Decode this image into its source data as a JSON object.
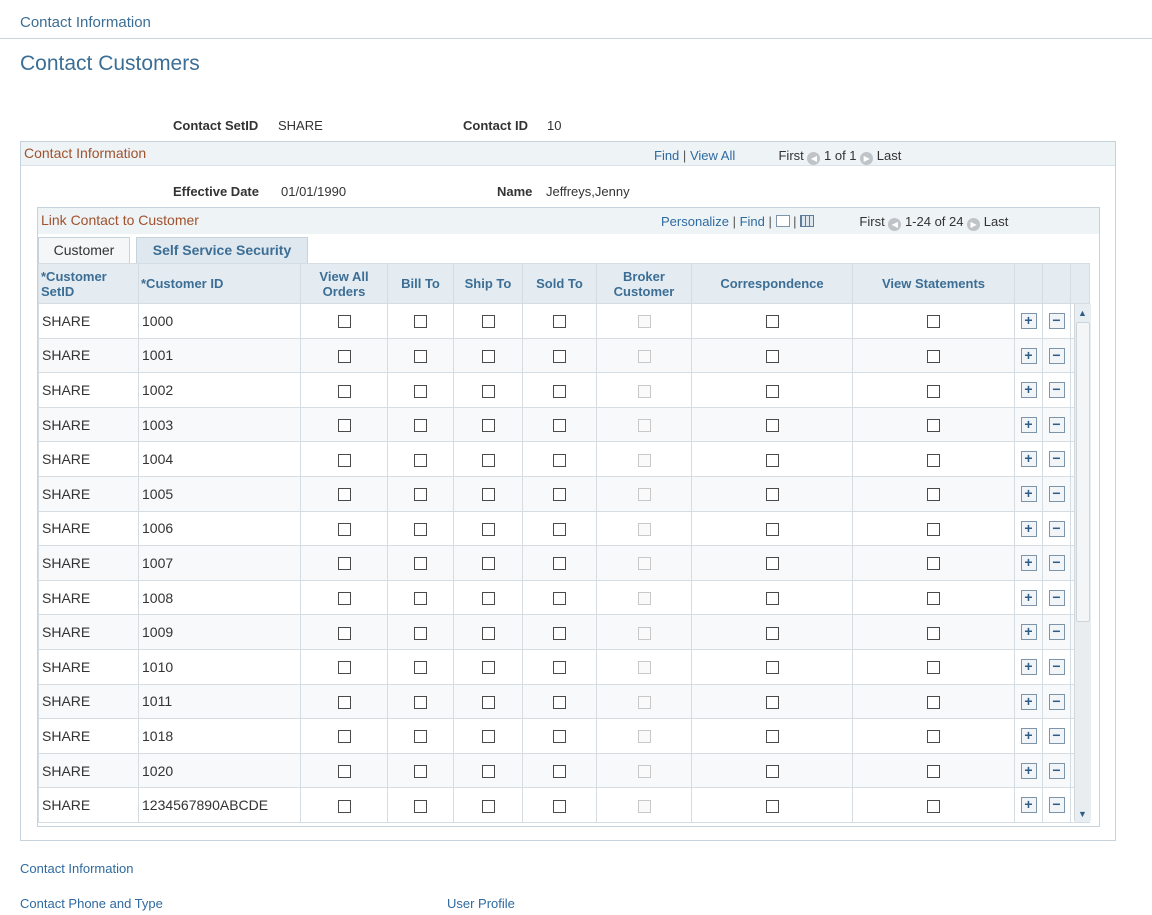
{
  "breadcrumb": "Contact Information",
  "page_title": "Contact Customers",
  "header": {
    "setid_label": "Contact SetID",
    "setid_value": "SHARE",
    "contactid_label": "Contact ID",
    "contactid_value": "10"
  },
  "contact_section": {
    "title": "Contact Information",
    "find": "Find",
    "sep": "|",
    "view_all": "View All",
    "first": "First",
    "range": "1 of 1",
    "last": "Last",
    "eff_date_label": "Effective Date",
    "eff_date_value": "01/01/1990",
    "name_label": "Name",
    "name_value": "Jeffreys,Jenny"
  },
  "grid": {
    "title": "Link Contact to Customer",
    "personalize": "Personalize",
    "find": "Find",
    "sep": "|",
    "first": "First",
    "range": "1-24 of 24",
    "last": "Last",
    "tabs": [
      "Customer",
      "Self Service Security"
    ],
    "columns": {
      "setid": "*Customer SetID",
      "custid": "*Customer ID",
      "view_all_orders": "View All Orders",
      "bill_to": "Bill To",
      "ship_to": "Ship To",
      "sold_to": "Sold To",
      "broker": "Broker Customer",
      "correspondence": "Correspondence",
      "view_statements": "View Statements"
    },
    "rows": [
      {
        "setid": "SHARE",
        "custid": "1000"
      },
      {
        "setid": "SHARE",
        "custid": "1001"
      },
      {
        "setid": "SHARE",
        "custid": "1002"
      },
      {
        "setid": "SHARE",
        "custid": "1003"
      },
      {
        "setid": "SHARE",
        "custid": "1004"
      },
      {
        "setid": "SHARE",
        "custid": "1005"
      },
      {
        "setid": "SHARE",
        "custid": "1006"
      },
      {
        "setid": "SHARE",
        "custid": "1007"
      },
      {
        "setid": "SHARE",
        "custid": "1008"
      },
      {
        "setid": "SHARE",
        "custid": "1009"
      },
      {
        "setid": "SHARE",
        "custid": "1010"
      },
      {
        "setid": "SHARE",
        "custid": "1011"
      },
      {
        "setid": "SHARE",
        "custid": "1018"
      },
      {
        "setid": "SHARE",
        "custid": "1020"
      },
      {
        "setid": "SHARE",
        "custid": "1234567890ABCDE"
      }
    ],
    "add_glyph": "+",
    "delete_glyph": "−"
  },
  "footer_links": {
    "contact_information": "Contact Information",
    "contact_phone": "Contact Phone and Type",
    "user_profile": "User Profile"
  },
  "icons": {
    "prev": "prev-arrow-icon",
    "next": "next-arrow-icon",
    "zoom": "zoom-icon",
    "download": "grid-download-icon"
  },
  "colors": {
    "title_blue": "#3c6e95",
    "section_brown": "#a0522d",
    "link_blue": "#2f6aa0",
    "header_bg": "#e4ecf2"
  }
}
